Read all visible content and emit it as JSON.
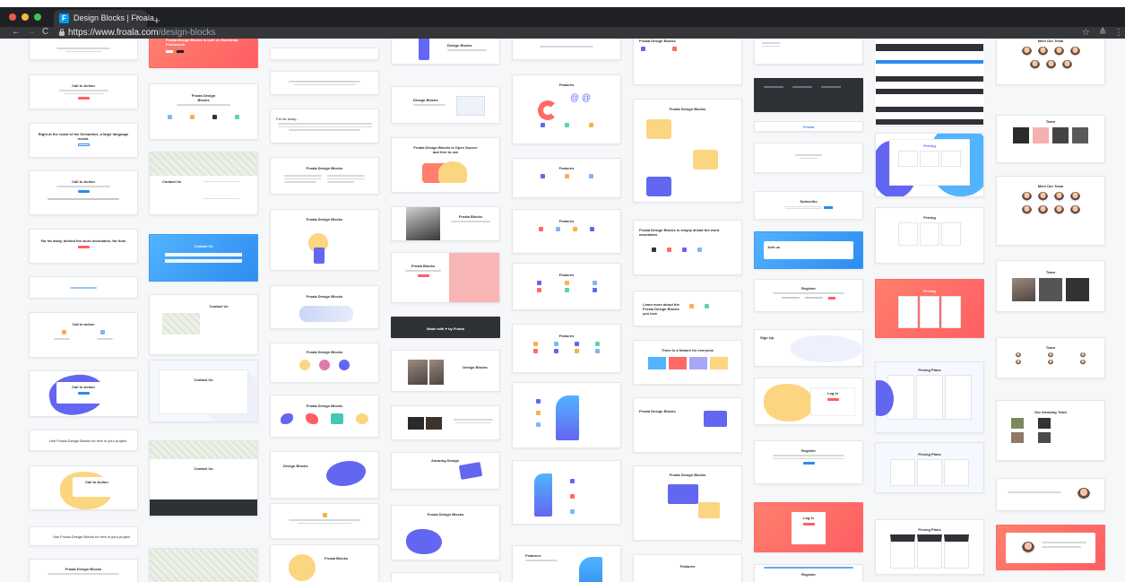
{
  "browser": {
    "tab_title": "Design Blocks | Froala",
    "tab_favicon_letter": "F",
    "close_glyph": "×",
    "new_tab_glyph": "+",
    "back_glyph": "←",
    "forward_glyph": "→",
    "reload_glyph": "C",
    "url_proto": "https://",
    "url_host": "www.froala.com",
    "url_path": "/design-blocks",
    "star_glyph": "☆",
    "extension_glyph": "≙",
    "menu_glyph": "⋮"
  },
  "colors": {
    "accent_blue": "#2d8cf0",
    "accent_coral": "#ff5e62",
    "accent_purple": "#6366f1",
    "accent_yellow": "#fcd581"
  },
  "columns": [
    {
      "cards": [
        {
          "title": "",
          "style": "plain"
        },
        {
          "title": "Call to Action",
          "style": "plain"
        },
        {
          "title": "Right at the coast of the Semantics, a large language ocean.",
          "style": "plain"
        },
        {
          "title": "Call to Action",
          "style": "plain"
        },
        {
          "title": "Far far away, behind the word mountains, far from",
          "style": "plain"
        },
        {
          "title": "",
          "style": "plain"
        },
        {
          "title": "Call to action",
          "style": "plain"
        },
        {
          "title": "Call to Action",
          "style": "plain"
        },
        {
          "title": "Use Froala Design Blocks for free in your project",
          "style": "plain"
        },
        {
          "title": "Call to Action",
          "style": "plain"
        },
        {
          "title": "Use Froala Design Blocks for free in your project",
          "style": "plain"
        },
        {
          "title": "Froala Design Blocks",
          "style": "plain"
        }
      ]
    },
    {
      "cards": [
        {
          "title": "Froala Design Blocks is built on Bootstrap Framework",
          "style": "coral"
        },
        {
          "title": "Froala Design Blocks",
          "style": "plain"
        },
        {
          "title": "Contact Us",
          "style": "plain"
        },
        {
          "title": "Contact Us",
          "style": "blue"
        },
        {
          "title": "Contact Us",
          "style": "plain"
        },
        {
          "title": "Contact Us",
          "style": "plain"
        },
        {
          "title": "Contact Us",
          "style": "plain"
        },
        {
          "title": "",
          "style": "plain"
        }
      ]
    },
    {
      "cards": [
        {
          "title": "",
          "style": "plain"
        },
        {
          "title": "",
          "style": "plain"
        },
        {
          "title": "Far far away...",
          "style": "plain"
        },
        {
          "title": "Froala Design Blocks",
          "style": "plain"
        },
        {
          "title": "Froala Design Blocks",
          "style": "plain"
        },
        {
          "title": "Froala Design Blocks",
          "style": "plain"
        },
        {
          "title": "Froala Design Blocks",
          "style": "plain"
        },
        {
          "title": "Froala Design Blocks",
          "style": "plain"
        },
        {
          "title": "Design Blocks",
          "style": "plain"
        },
        {
          "title": "",
          "style": "plain"
        },
        {
          "title": "Froala Blocks",
          "style": "plain"
        }
      ]
    },
    {
      "cards": [
        {
          "title": "Design Blocks",
          "style": "plain"
        },
        {
          "title": "Design Blocks",
          "style": "plain"
        },
        {
          "title": "Froala Design Blocks is Open Source and free to use",
          "style": "plain"
        },
        {
          "title": "Froala Blocks",
          "style": "plain"
        },
        {
          "title": "Froala Blocks",
          "style": "plain"
        },
        {
          "title": "Made with ♥ by Froala",
          "style": "dark"
        },
        {
          "title": "Design Blocks",
          "style": "plain"
        },
        {
          "title": "",
          "style": "plain"
        },
        {
          "title": "Amazing Design",
          "style": "plain"
        },
        {
          "title": "Froala Design Blocks",
          "style": "plain"
        },
        {
          "title": "",
          "style": "plain"
        }
      ]
    },
    {
      "cards": [
        {
          "title": "",
          "style": "plain"
        },
        {
          "title": "Features",
          "style": "plain"
        },
        {
          "title": "Features",
          "style": "plain"
        },
        {
          "title": "Features",
          "style": "plain"
        },
        {
          "title": "Features",
          "style": "plain"
        },
        {
          "title": "Features",
          "style": "plain"
        },
        {
          "title": "",
          "style": "plain"
        },
        {
          "title": "",
          "style": "plain"
        },
        {
          "title": "Features:",
          "style": "plain"
        }
      ]
    },
    {
      "cards": [
        {
          "title": "Froala Design Blocks",
          "style": "plain"
        },
        {
          "title": "Froala Design Blocks",
          "style": "plain"
        },
        {
          "title": "Froala Design Blocks is simply ahead the word mountains",
          "style": "plain"
        },
        {
          "title": "Learn more about the Froala Design Blocks you love",
          "style": "plain"
        },
        {
          "title": "There is a feature for everyone",
          "style": "plain"
        },
        {
          "title": "Froala Design Blocks",
          "style": "plain"
        },
        {
          "title": "Froala Design Blocks",
          "style": "plain"
        },
        {
          "title": "Features",
          "style": "plain"
        }
      ]
    },
    {
      "cards": [
        {
          "title": "",
          "style": "plain"
        },
        {
          "title": "",
          "style": "dark"
        },
        {
          "title": "Froala",
          "style": "plain"
        },
        {
          "title": "",
          "style": "plain"
        },
        {
          "title": "Subscribe",
          "style": "plain"
        },
        {
          "title": "Join us",
          "style": "blue"
        },
        {
          "title": "Register",
          "style": "plain"
        },
        {
          "title": "Sign Up",
          "style": "plain"
        },
        {
          "title": "Log In",
          "style": "plain"
        },
        {
          "title": "Register",
          "style": "plain"
        },
        {
          "title": "Log In",
          "style": "coral"
        },
        {
          "title": "Register",
          "style": "plain"
        }
      ]
    },
    {
      "cards": [
        {
          "title": "",
          "style": "plain"
        },
        {
          "title": "Pricing",
          "style": "plain"
        },
        {
          "title": "Pricing",
          "style": "plain"
        },
        {
          "title": "Pricing",
          "style": "coral"
        },
        {
          "title": "Pricing Plans",
          "style": "plain"
        },
        {
          "title": "Pricing Plans",
          "style": "plain"
        },
        {
          "title": "Pricing Plans",
          "style": "plain"
        }
      ]
    },
    {
      "cards": [
        {
          "title": "Meet Our Team",
          "style": "plain"
        },
        {
          "title": "Team",
          "style": "plain"
        },
        {
          "title": "Meet Our Team",
          "style": "plain"
        },
        {
          "title": "Team",
          "style": "plain"
        },
        {
          "title": "Team",
          "style": "plain"
        },
        {
          "title": "Our Amazing Team",
          "style": "plain"
        },
        {
          "title": "",
          "style": "plain"
        },
        {
          "title": "",
          "style": "coral"
        }
      ]
    }
  ]
}
